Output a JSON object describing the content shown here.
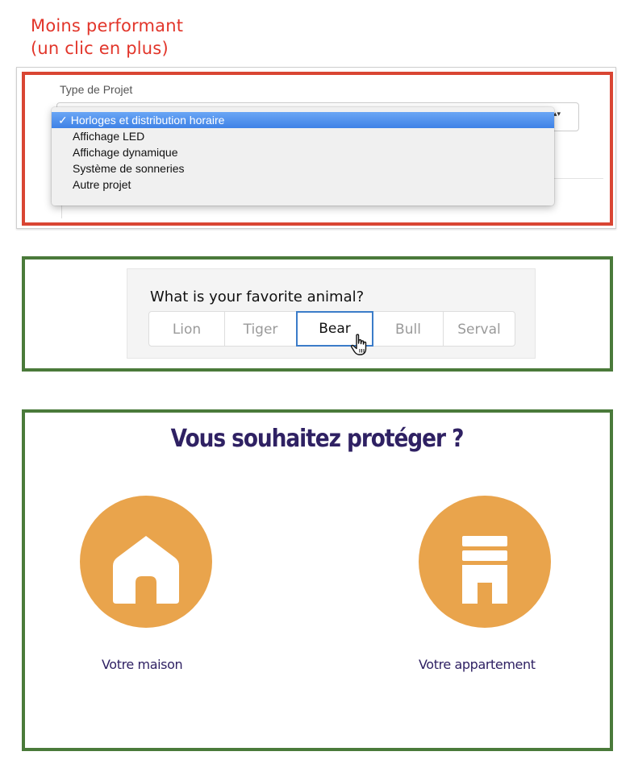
{
  "caption": {
    "line1": "Moins performant",
    "line2": "(un clic en plus)"
  },
  "panel1": {
    "field_label": "Type de Projet",
    "checkmark": "✓",
    "options": [
      "Horloges et distribution horaire",
      "Affichage LED",
      "Affichage dynamique",
      "Système de sonneries",
      "Autre projet"
    ],
    "selected_index": 0,
    "select_arrows": "▴▾"
  },
  "panel2": {
    "question": "What is your favorite animal?",
    "options": [
      "Lion",
      "Tiger",
      "Bear",
      "Bull",
      "Serval"
    ],
    "selected": "Bear",
    "cursor_icon": "pointing-hand-cursor"
  },
  "panel3": {
    "title": "Vous souhaitez protéger ?",
    "options": [
      {
        "label": "Votre maison",
        "icon": "house-icon"
      },
      {
        "label": "Votre appartement",
        "icon": "apartment-building-icon"
      }
    ]
  },
  "colors": {
    "caption_red": "#e2352a",
    "red_frame": "#d94533",
    "green_frame": "#4a7a3a",
    "selected_blue": "#3f82e6",
    "segment_active_border": "#3b7cc9",
    "circle_orange": "#e9a44c",
    "title_purple": "#2f2163"
  }
}
